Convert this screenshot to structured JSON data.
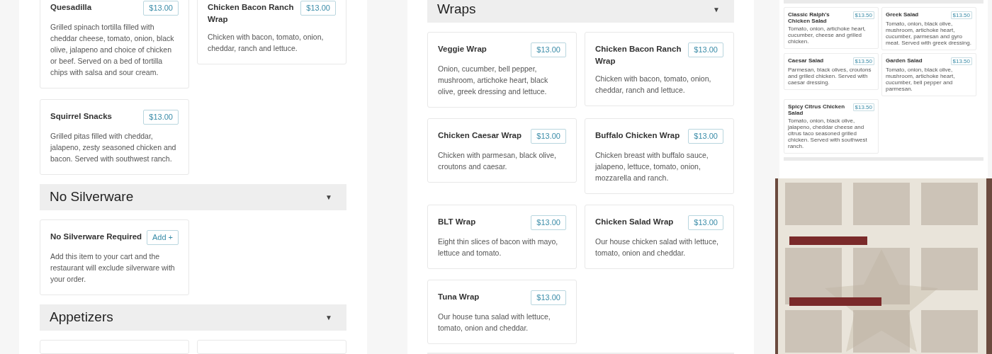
{
  "panels": [
    {
      "blocks": [
        {
          "kind": "cards",
          "items": [
            {
              "name": "Quesadilla",
              "tag": "$13.00",
              "description": "Grilled spinach tortilla filled with cheddar cheese, tomato, onion, black olive, jalapeno and choice of chicken or beef. Served on a bed of tortilla chips with salsa and sour cream."
            },
            {
              "name": "Chicken Bacon Ranch Wrap",
              "tag": "$13.00",
              "description": "Chicken with bacon, tomato, onion, cheddar, ranch and lettuce."
            },
            {
              "name": "Squirrel Snacks",
              "tag": "$13.00",
              "description": "Grilled pitas filled with cheddar, jalapeno, zesty seasoned chicken and bacon. Served with southwest ranch."
            }
          ]
        },
        {
          "kind": "header",
          "title": "No Silverware",
          "arrow": "▼"
        },
        {
          "kind": "cards",
          "items": [
            {
              "name": "No Silverware Required",
              "tag": "Add +",
              "description": "Add this item to your cart and the restaurant will exclude silverware with your order."
            }
          ]
        },
        {
          "kind": "header",
          "title": "Appetizers",
          "arrow": "▼"
        }
      ]
    },
    {
      "blocks": [
        {
          "kind": "header",
          "title": "Wraps",
          "arrow": "▼"
        },
        {
          "kind": "cards",
          "items": [
            {
              "name": "Veggie Wrap",
              "tag": "$13.00",
              "description": "Onion, cucumber, bell pepper, mushroom, artichoke heart, black olive, greek dressing and lettuce."
            },
            {
              "name": "Chicken Bacon Ranch Wrap",
              "tag": "$13.00",
              "description": "Chicken with bacon, tomato, onion, cheddar, ranch and lettuce."
            },
            {
              "name": "Chicken Caesar Wrap",
              "tag": "$13.00",
              "description": "Chicken with parmesan, black olive, croutons and caesar."
            },
            {
              "name": "Buffalo Chicken Wrap",
              "tag": "$13.00",
              "description": "Chicken breast with buffalo sauce, jalapeno, lettuce, tomato, onion, mozzarella and ranch."
            },
            {
              "name": "BLT Wrap",
              "tag": "$13.00",
              "description": "Eight thin slices of bacon with mayo, lettuce and tomato."
            },
            {
              "name": "Chicken Salad Wrap",
              "tag": "$13.00",
              "description": "Our house chicken salad with lettuce, tomato, onion and cheddar."
            },
            {
              "name": "Tuna Wrap",
              "tag": "$13.00",
              "description": "Our house tuna salad with lettuce, tomato, onion and cheddar."
            }
          ]
        }
      ]
    },
    {
      "blocks": [
        {
          "kind": "cards",
          "items": [
            {
              "name": "Classic Ralph's Chicken Salad",
              "tag": "$13.50",
              "description": "Tomato, onion, artichoke heart, cucumber, cheese and grilled chicken."
            },
            {
              "name": "Greek Salad",
              "tag": "$13.50",
              "description": "Tomato, onion, black olive, mushroom, artichoke heart, cucumber, parmesan and gyro meat. Served with greek dressing."
            },
            {
              "name": "Caesar Salad",
              "tag": "$13.50",
              "description": "Parmesan, black olives, croutons and grilled chicken. Served with caesar dressing."
            },
            {
              "name": "Garden Salad",
              "tag": "$13.50",
              "description": "Tomato, onion, black olive, mushroom, artichoke heart, cucumber, bell pepper and parmesan."
            },
            {
              "name": "Spicy Citrus Chicken Salad",
              "tag": "$13.50",
              "description": "Tomato, onion, black olive, jalapeno, cheddar cheese and citrus taco seasoned grilled chicken. Served with southwest ranch."
            }
          ]
        }
      ]
    }
  ]
}
